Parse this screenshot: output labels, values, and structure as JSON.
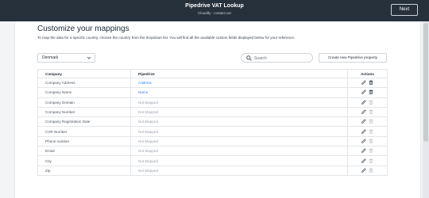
{
  "header": {
    "title": "Pipedrive VAT Lookup",
    "subtitle": "Cloudify - contact us!",
    "next_label": "Next"
  },
  "page": {
    "heading": "Customize your mappings",
    "description": "To map the data for a specific country, choose the country from the dropdown list. You will find all the available custom fields displayed below for your reference."
  },
  "controls": {
    "country": "Denmark",
    "search_placeholder": "Search",
    "create_label": "Create new Pipedrive property"
  },
  "table": {
    "headers": {
      "company": "Company",
      "pipedrive": "Pipedrive",
      "actions": "Actions"
    },
    "rows": [
      {
        "company": "Company Address",
        "pipedrive": "Address",
        "mapped": true
      },
      {
        "company": "Company Name",
        "pipedrive": "Name",
        "mapped": true
      },
      {
        "company": "Company Domain",
        "pipedrive": "Not Mapped",
        "mapped": false
      },
      {
        "company": "Company Number",
        "pipedrive": "Not Mapped",
        "mapped": false
      },
      {
        "company": "Company Registration Date",
        "pipedrive": "Not Mapped",
        "mapped": false
      },
      {
        "company": "CVR Number",
        "pipedrive": "Not Mapped",
        "mapped": false
      },
      {
        "company": "Phone number",
        "pipedrive": "Not Mapped",
        "mapped": false
      },
      {
        "company": "Email",
        "pipedrive": "Not Mapped",
        "mapped": false
      },
      {
        "company": "City",
        "pipedrive": "Not Mapped",
        "mapped": false
      },
      {
        "company": "Zip",
        "pipedrive": "Not Mapped",
        "mapped": false
      }
    ]
  },
  "colors": {
    "topbar": "#27313c",
    "mapped_link": "#3b82f6",
    "unmapped_text": "#9ca3af"
  },
  "icons": {
    "edit": "pencil-icon",
    "delete": "trash-icon",
    "search": "search-icon",
    "dropdown": "chevron-down-icon"
  }
}
